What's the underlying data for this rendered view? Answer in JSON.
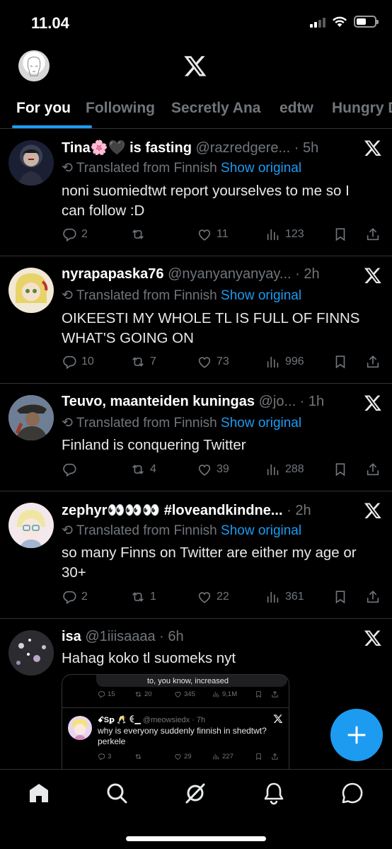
{
  "status": {
    "time": "11.04"
  },
  "tabs": [
    {
      "label": "For you"
    },
    {
      "label": "Following"
    },
    {
      "label": "Secretly Ana"
    },
    {
      "label": "edtw"
    },
    {
      "label": "Hungry D"
    }
  ],
  "translated_label": "Translated from Finnish",
  "show_original_label": "Show original",
  "tweets": [
    {
      "name": "Tina🌸🖤 is fasting",
      "handle": "@razredgere...",
      "time": "5h",
      "text": "noni suomiedtwt report yourselves to me so I can follow :D",
      "replies": "2",
      "retweets": "",
      "likes": "11",
      "views": "123"
    },
    {
      "name": "nyrapapaska76",
      "handle": "@nyanyanyanyay...",
      "time": "2h",
      "text": "OIKEESTI MY WHOLE TL IS FULL OF FINNS WHAT'S GOING ON",
      "replies": "10",
      "retweets": "7",
      "likes": "73",
      "views": "996"
    },
    {
      "name": "Teuvo, maanteiden kuningas",
      "handle": "@jo...",
      "time": "1h",
      "text": "Finland is conquering Twitter",
      "replies": "",
      "retweets": "4",
      "likes": "39",
      "views": "288"
    },
    {
      "name": "zephyr👀👀👀 #loveandkindne...",
      "handle": "",
      "time": "2h",
      "text": "so many Finns on Twitter are either my age or 30+",
      "replies": "2",
      "retweets": "1",
      "likes": "22",
      "views": "361"
    },
    {
      "name": "isa",
      "handle": "@1iiisaaaa",
      "time": "6h",
      "text": "Hahag koko tl suomeks nyt"
    }
  ],
  "embed": {
    "top_text": "to, you know, increased",
    "top_stats": {
      "replies": "15",
      "retweets": "20",
      "likes": "345",
      "views": "9,1M"
    },
    "quoted_name": "ꗃSꝑ 🥂 ꑀ▁",
    "quoted_handle": "@meowsiedx",
    "quoted_time": "7h",
    "quoted_text": "why is everyony suddenly finnish in shedtwt? perkele",
    "quoted_stats": {
      "replies": "3",
      "retweets": "",
      "likes": "29",
      "views": "227"
    }
  },
  "colors": {
    "accent": "#1d9bf0",
    "background": "#000000",
    "muted": "#71767b",
    "divider": "#2f3336"
  },
  "icons": [
    "x-logo-icon",
    "reply-icon",
    "retweet-icon",
    "like-icon",
    "views-icon",
    "bookmark-icon",
    "share-icon",
    "compose-icon",
    "home-icon",
    "search-icon",
    "grok-icon",
    "notifications-icon",
    "messages-icon"
  ]
}
